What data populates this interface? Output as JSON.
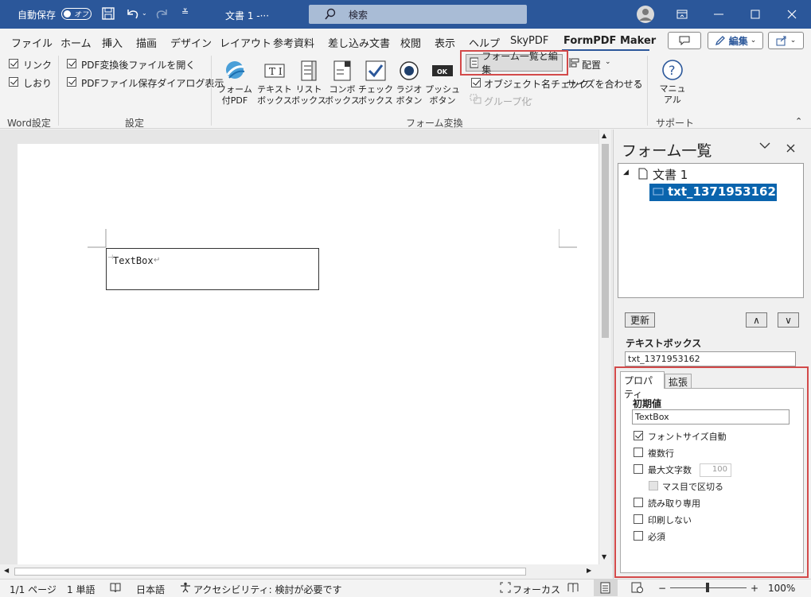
{
  "titlebar": {
    "autosave_label": "自動保存",
    "autosave_state": "オフ",
    "doc_title": "文書 1  -···",
    "search_placeholder": "検索"
  },
  "menu": {
    "tabs": [
      "ファイル",
      "ホーム",
      "挿入",
      "描画",
      "デザイン",
      "レイアウト",
      "参考資料",
      "差し込み文書",
      "校閲",
      "表示",
      "ヘルプ",
      "SkyPDF",
      "FormPDF Maker"
    ],
    "active_tab": "FormPDF Maker",
    "edit_button": "編集"
  },
  "ribbon": {
    "word_settings": {
      "link": "リンク",
      "bookmark": "しおり",
      "group": "Word設定"
    },
    "settings": {
      "open_after": "PDF変換後ファイルを開く",
      "save_dialog": "PDFファイル保存ダイアログ表示",
      "group": "設定"
    },
    "form_convert": {
      "buttons": [
        {
          "line1": "フォーム",
          "line2": "付PDF"
        },
        {
          "line1": "テキスト",
          "line2": "ボックス"
        },
        {
          "line1": "リスト",
          "line2": "ボックス"
        },
        {
          "line1": "コンボ",
          "line2": "ボックス"
        },
        {
          "line1": "チェック",
          "line2": "ボックス"
        },
        {
          "line1": "ラジオ",
          "line2": "ボタン"
        },
        {
          "line1": "プッシュ",
          "line2": "ボタン"
        }
      ],
      "form_list_edit": "フォーム一覧と編集",
      "object_name_check": "オブジェクト名チェック",
      "group_btn": "グループ化",
      "arrange": "配置",
      "fit_size": "サイズを合わせる",
      "group": "フォーム変換"
    },
    "support": {
      "manual_line1": "マニュ",
      "manual_line2": "アル",
      "group": "サポート"
    }
  },
  "document": {
    "textbox_text": "TextBox"
  },
  "pane": {
    "title": "フォーム一覧",
    "tree_root": "文書 1",
    "tree_child": "txt_1371953162",
    "refresh": "更新",
    "up": "∧",
    "down": "∨",
    "type_label": "テキストボックス",
    "name_value": "txt_1371953162",
    "tabs": [
      "プロパティ",
      "拡張"
    ],
    "initial_value_label": "初期値",
    "initial_value": "TextBox",
    "options": {
      "font_auto": "フォントサイズ自動",
      "multiline": "複数行",
      "max_chars": "最大文字数",
      "max_chars_value": "100",
      "comb": "マス目で区切る",
      "readonly": "読み取り専用",
      "noprint": "印刷しない",
      "required": "必須"
    }
  },
  "status": {
    "page": "1/1 ページ",
    "words": "1 単語",
    "lang": "日本語",
    "accessibility": "アクセシビリティ: 検討が必要です",
    "focus": "フォーカス",
    "zoom": "100%"
  },
  "colors": {
    "accent": "#2b579a",
    "highlight": "#d34a4a",
    "selection": "#0a64ad"
  }
}
